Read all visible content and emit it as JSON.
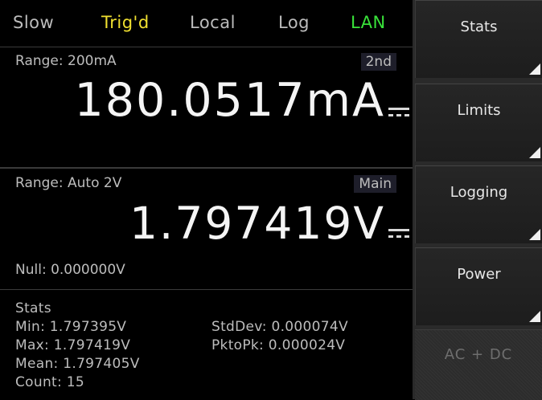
{
  "colors": {
    "trigger_yellow": "#f0e030",
    "lan_green": "#39e23a",
    "text_grey": "#bdbdbd",
    "reading_white": "#f4f4f4"
  },
  "status_bar": {
    "speed": "Slow",
    "trigger": "Trig'd",
    "remote": "Local",
    "log": "Log",
    "lan": "LAN"
  },
  "secondary": {
    "range": "Range: 200mA",
    "tag": "2nd",
    "reading": "180.0517mA"
  },
  "main": {
    "range": "Range: Auto 2V",
    "tag": "Main",
    "reading": "1.797419V",
    "null": "Null: 0.000000V"
  },
  "stats": {
    "title": "Stats",
    "min": "Min:   1.797395V",
    "max": "Max:  1.797419V",
    "mean": "Mean: 1.797405V",
    "count": "Count: 15",
    "stddev": "StdDev: 0.000074V",
    "pktopk": "PktoPk: 0.000024V"
  },
  "softkeys": {
    "stats": "Stats",
    "limits": "Limits",
    "logging": "Logging",
    "power": "Power",
    "acdc": "AC + DC"
  }
}
